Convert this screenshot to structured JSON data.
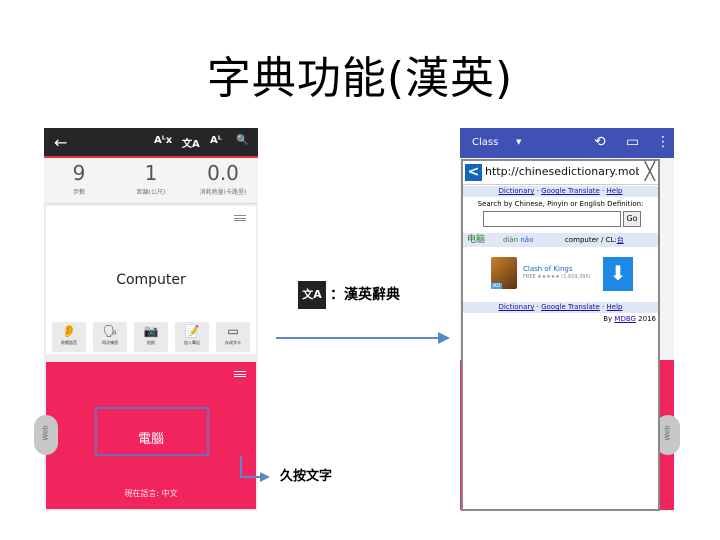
{
  "slide": {
    "title": "字典功能(漢英)"
  },
  "left_phone": {
    "topbar": {
      "back_icon": "←",
      "icons": [
        "Aᴸx",
        "文A",
        "Aᴸ",
        "🔍"
      ]
    },
    "stats": [
      {
        "value": "9",
        "label": "步數"
      },
      {
        "value": "1",
        "label": "距離(公尺)"
      },
      {
        "value": "0.0",
        "label": "消耗熱量(卡路里)"
      }
    ],
    "card": {
      "word": "Computer"
    },
    "actions": [
      {
        "icon": "ear-icon",
        "glyph": "👂",
        "label": "聆聽語音"
      },
      {
        "icon": "voice-icon",
        "glyph": "🗣",
        "label": "再次練習"
      },
      {
        "icon": "camera-icon",
        "glyph": "📷",
        "label": "拍照"
      },
      {
        "icon": "note-icon",
        "glyph": "📝",
        "label": "加入筆記"
      },
      {
        "icon": "card-icon",
        "glyph": "▭",
        "label": "存成字卡"
      }
    ],
    "pink_card": {
      "word": "電腦",
      "language": "現在語言: 中文"
    },
    "side_tab": "Web"
  },
  "annotation": {
    "hold_label": "久按文字"
  },
  "middle": {
    "icon_text": "文A",
    "label": "：漢英辭典"
  },
  "right_phone": {
    "topbar": {
      "class_label": "Class",
      "dropdown": "▼"
    },
    "side_tab": "Web",
    "popup": {
      "url": "http://chinesedictionary.mobi/?t",
      "back": "<",
      "close": "╳",
      "links": {
        "dictionary": "Dictionary",
        "google": "Google Translate",
        "help": "Help",
        "sep": " · "
      },
      "search_label": "Search by Chinese, Pinyin or English Definition:",
      "go": "Go",
      "result": {
        "hanzi": "电脑",
        "pinyin1": "diàn",
        "pinyin2": "nǎo",
        "definition": "computer / CL:",
        "cl": "台"
      },
      "ad": {
        "name": "Clash of Kings",
        "meta": "FREE ★★★★★ (1,659,395)",
        "tag": "AD",
        "download": "⬇"
      },
      "credit_by": "By ",
      "credit_link": "MDBG",
      "credit_year": " 2016"
    }
  },
  "colors": {
    "pink": "#f2245e",
    "indigo": "#3f51b5",
    "arrow": "#5b86c8"
  }
}
